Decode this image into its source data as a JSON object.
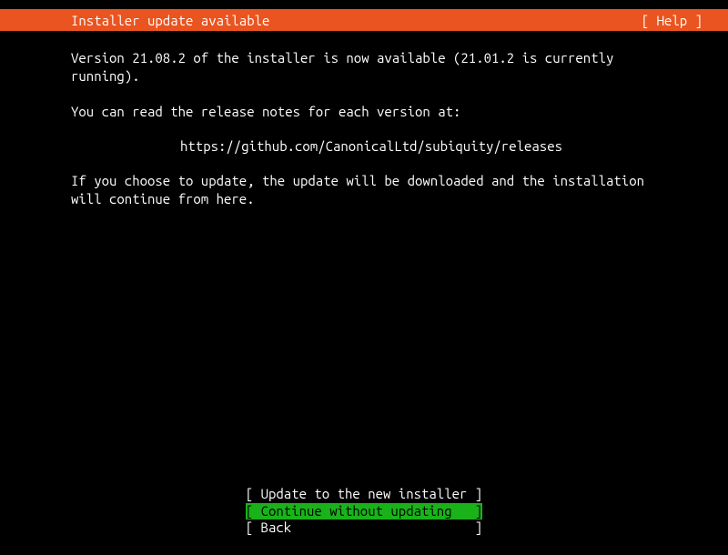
{
  "header": {
    "title": "Installer update available",
    "help": "[ Help ]"
  },
  "body": {
    "line1": "Version 21.08.2 of the installer is now available (21.01.2 is currently running).",
    "line2": "You can read the release notes for each version at:",
    "url": "https://github.com/CanonicalLtd/subiquity/releases",
    "line3": "If you choose to update, the update will be downloaded and the installation will continue from here."
  },
  "buttons": {
    "update": "[ Update to the new installer ]",
    "continue": "[ Continue without updating   ]",
    "back": "[ Back                        ]"
  }
}
